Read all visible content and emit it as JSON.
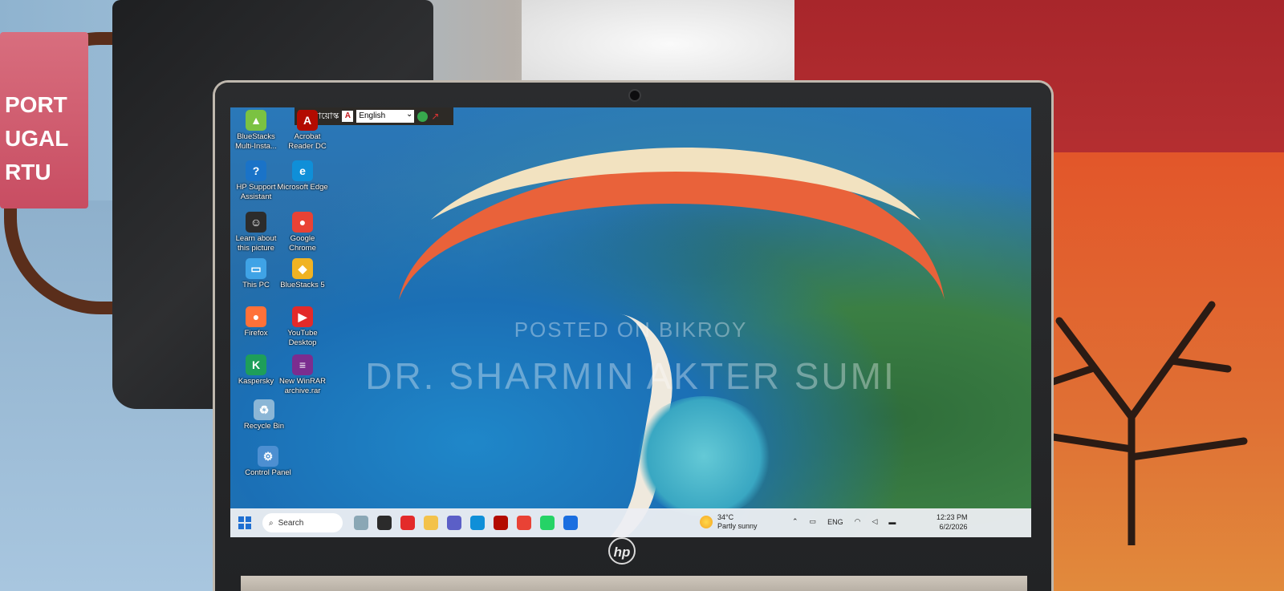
{
  "background": {
    "card_lines": [
      "PORT",
      "UGAL",
      "RTU"
    ]
  },
  "keyboard_toolbar": {
    "name": "বায়োস্ক",
    "language": "English"
  },
  "desktop_icons": [
    {
      "id": "bluestacks-multi",
      "label": "BlueStacks Multi-Insta...",
      "color": "#7bc242",
      "glyph": "▲"
    },
    {
      "id": "acrobat",
      "label": "Acrobat Reader DC",
      "color": "#b30b00",
      "glyph": "A"
    },
    {
      "id": "hp-support",
      "label": "HP Support Assistant",
      "color": "#1a73c8",
      "glyph": "?"
    },
    {
      "id": "edge",
      "label": "Microsoft Edge",
      "color": "#0f8fd8",
      "glyph": "e"
    },
    {
      "id": "learn-picture",
      "label": "Learn about this picture",
      "color": "#2c2c2c",
      "glyph": "☺"
    },
    {
      "id": "chrome",
      "label": "Google Chrome",
      "color": "#e94235",
      "glyph": "●"
    },
    {
      "id": "this-pc",
      "label": "This PC",
      "color": "#3fa3e6",
      "glyph": "▭"
    },
    {
      "id": "bluestacks5",
      "label": "BlueStacks 5",
      "color": "#f0b323",
      "glyph": "◆"
    },
    {
      "id": "firefox",
      "label": "Firefox",
      "color": "#ff7139",
      "glyph": "●"
    },
    {
      "id": "youtube-desktop",
      "label": "YouTube Desktop",
      "color": "#e32a2a",
      "glyph": "▶"
    },
    {
      "id": "kaspersky",
      "label": "Kaspersky",
      "color": "#1e9e5a",
      "glyph": "K"
    },
    {
      "id": "winrar",
      "label": "New WinRAR archive.rar",
      "color": "#7b2d8f",
      "glyph": "≡"
    },
    {
      "id": "recycle-bin",
      "label": "Recycle Bin",
      "color": "#8bb6d6",
      "glyph": "♻"
    },
    {
      "id": "control-panel",
      "label": "Control Panel",
      "color": "#4d8fd1",
      "glyph": "⚙"
    }
  ],
  "watermark": {
    "line1": "POSTED ON BIKROY",
    "line2": "DR. SHARMIN AKTER SUMI"
  },
  "taskbar": {
    "search_placeholder": "Search",
    "weather_temp": "34°C",
    "weather_desc": "Partly sunny",
    "language": "ENG",
    "time": "12:23 PM",
    "date": "6/2/2026",
    "apps": [
      {
        "name": "widgets",
        "color": "#8aa7b5"
      },
      {
        "name": "task-view",
        "color": "#2b2b2b"
      },
      {
        "name": "youtube",
        "color": "#e32a2a"
      },
      {
        "name": "file-explorer",
        "color": "#f3c24b"
      },
      {
        "name": "teams",
        "color": "#5b5fc7"
      },
      {
        "name": "edge",
        "color": "#0f8fd8"
      },
      {
        "name": "acrobat",
        "color": "#b30b00"
      },
      {
        "name": "chrome",
        "color": "#e94235"
      },
      {
        "name": "whatsapp",
        "color": "#25d366"
      },
      {
        "name": "bluestacks",
        "color": "#1a6ee0"
      }
    ]
  },
  "laptop": {
    "brand": "hp"
  }
}
